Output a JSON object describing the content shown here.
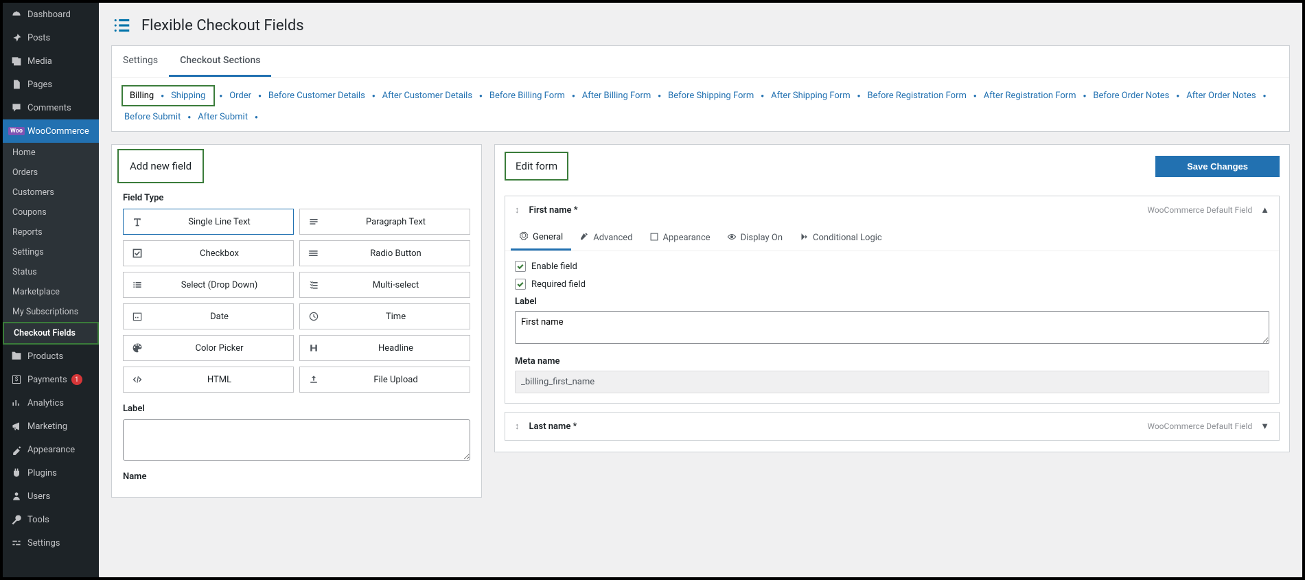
{
  "sidebar": {
    "main": [
      {
        "icon": "dashboard",
        "label": "Dashboard"
      },
      {
        "icon": "pin",
        "label": "Posts"
      },
      {
        "icon": "media",
        "label": "Media"
      },
      {
        "icon": "pages",
        "label": "Pages"
      },
      {
        "icon": "comments",
        "label": "Comments"
      },
      {
        "icon": "wc",
        "label": "WooCommerce",
        "active": true
      }
    ],
    "wc_sub": [
      {
        "label": "Home"
      },
      {
        "label": "Orders"
      },
      {
        "label": "Customers"
      },
      {
        "label": "Coupons"
      },
      {
        "label": "Reports"
      },
      {
        "label": "Settings"
      },
      {
        "label": "Status"
      },
      {
        "label": "Marketplace"
      },
      {
        "label": "My Subscriptions"
      },
      {
        "label": "Checkout Fields",
        "boxed": true,
        "current": true
      }
    ],
    "after": [
      {
        "icon": "products",
        "label": "Products"
      },
      {
        "icon": "payments",
        "label": "Payments",
        "count": "1"
      },
      {
        "icon": "analytics",
        "label": "Analytics"
      },
      {
        "icon": "marketing",
        "label": "Marketing"
      },
      {
        "icon": "appearance",
        "label": "Appearance"
      },
      {
        "icon": "plugins",
        "label": "Plugins"
      },
      {
        "icon": "users",
        "label": "Users"
      },
      {
        "icon": "tools",
        "label": "Tools"
      },
      {
        "icon": "settings",
        "label": "Settings"
      }
    ]
  },
  "page_title": "Flexible Checkout Fields",
  "tabs": {
    "settings": "Settings",
    "sections": "Checkout Sections"
  },
  "sections_boxed": [
    "Billing",
    "Shipping"
  ],
  "sections": [
    "Order",
    "Before Customer Details",
    "After Customer Details",
    "Before Billing Form",
    "After Billing Form",
    "Before Shipping Form",
    "After Shipping Form",
    "Before Registration Form",
    "After Registration Form",
    "Before Order Notes",
    "After Order Notes",
    "Before Submit",
    "After Submit"
  ],
  "left_panel": {
    "title": "Add new field",
    "field_type_label": "Field Type",
    "types": [
      {
        "icon": "text",
        "label": "Single Line Text",
        "active": true
      },
      {
        "icon": "paragraph",
        "label": "Paragraph Text"
      },
      {
        "icon": "checkbox",
        "label": "Checkbox"
      },
      {
        "icon": "radio",
        "label": "Radio Button"
      },
      {
        "icon": "select",
        "label": "Select (Drop Down)"
      },
      {
        "icon": "multiselect",
        "label": "Multi-select"
      },
      {
        "icon": "date",
        "label": "Date"
      },
      {
        "icon": "time",
        "label": "Time"
      },
      {
        "icon": "color",
        "label": "Color Picker"
      },
      {
        "icon": "headline",
        "label": "Headline"
      },
      {
        "icon": "html",
        "label": "HTML"
      },
      {
        "icon": "file",
        "label": "File Upload"
      }
    ],
    "label_label": "Label",
    "name_label": "Name"
  },
  "right_panel": {
    "title": "Edit form",
    "save": "Save Changes",
    "rows": [
      {
        "name": "First name *",
        "meta": "WooCommerce Default Field",
        "expanded": true
      },
      {
        "name": "Last name *",
        "meta": "WooCommerce Default Field",
        "expanded": false
      }
    ],
    "row_tabs": [
      "General",
      "Advanced",
      "Appearance",
      "Display On",
      "Conditional Logic"
    ],
    "enable_label": "Enable field",
    "required_label": "Required field",
    "label_label": "Label",
    "label_value": "First name",
    "meta_label": "Meta name",
    "meta_value": "_billing_first_name"
  }
}
